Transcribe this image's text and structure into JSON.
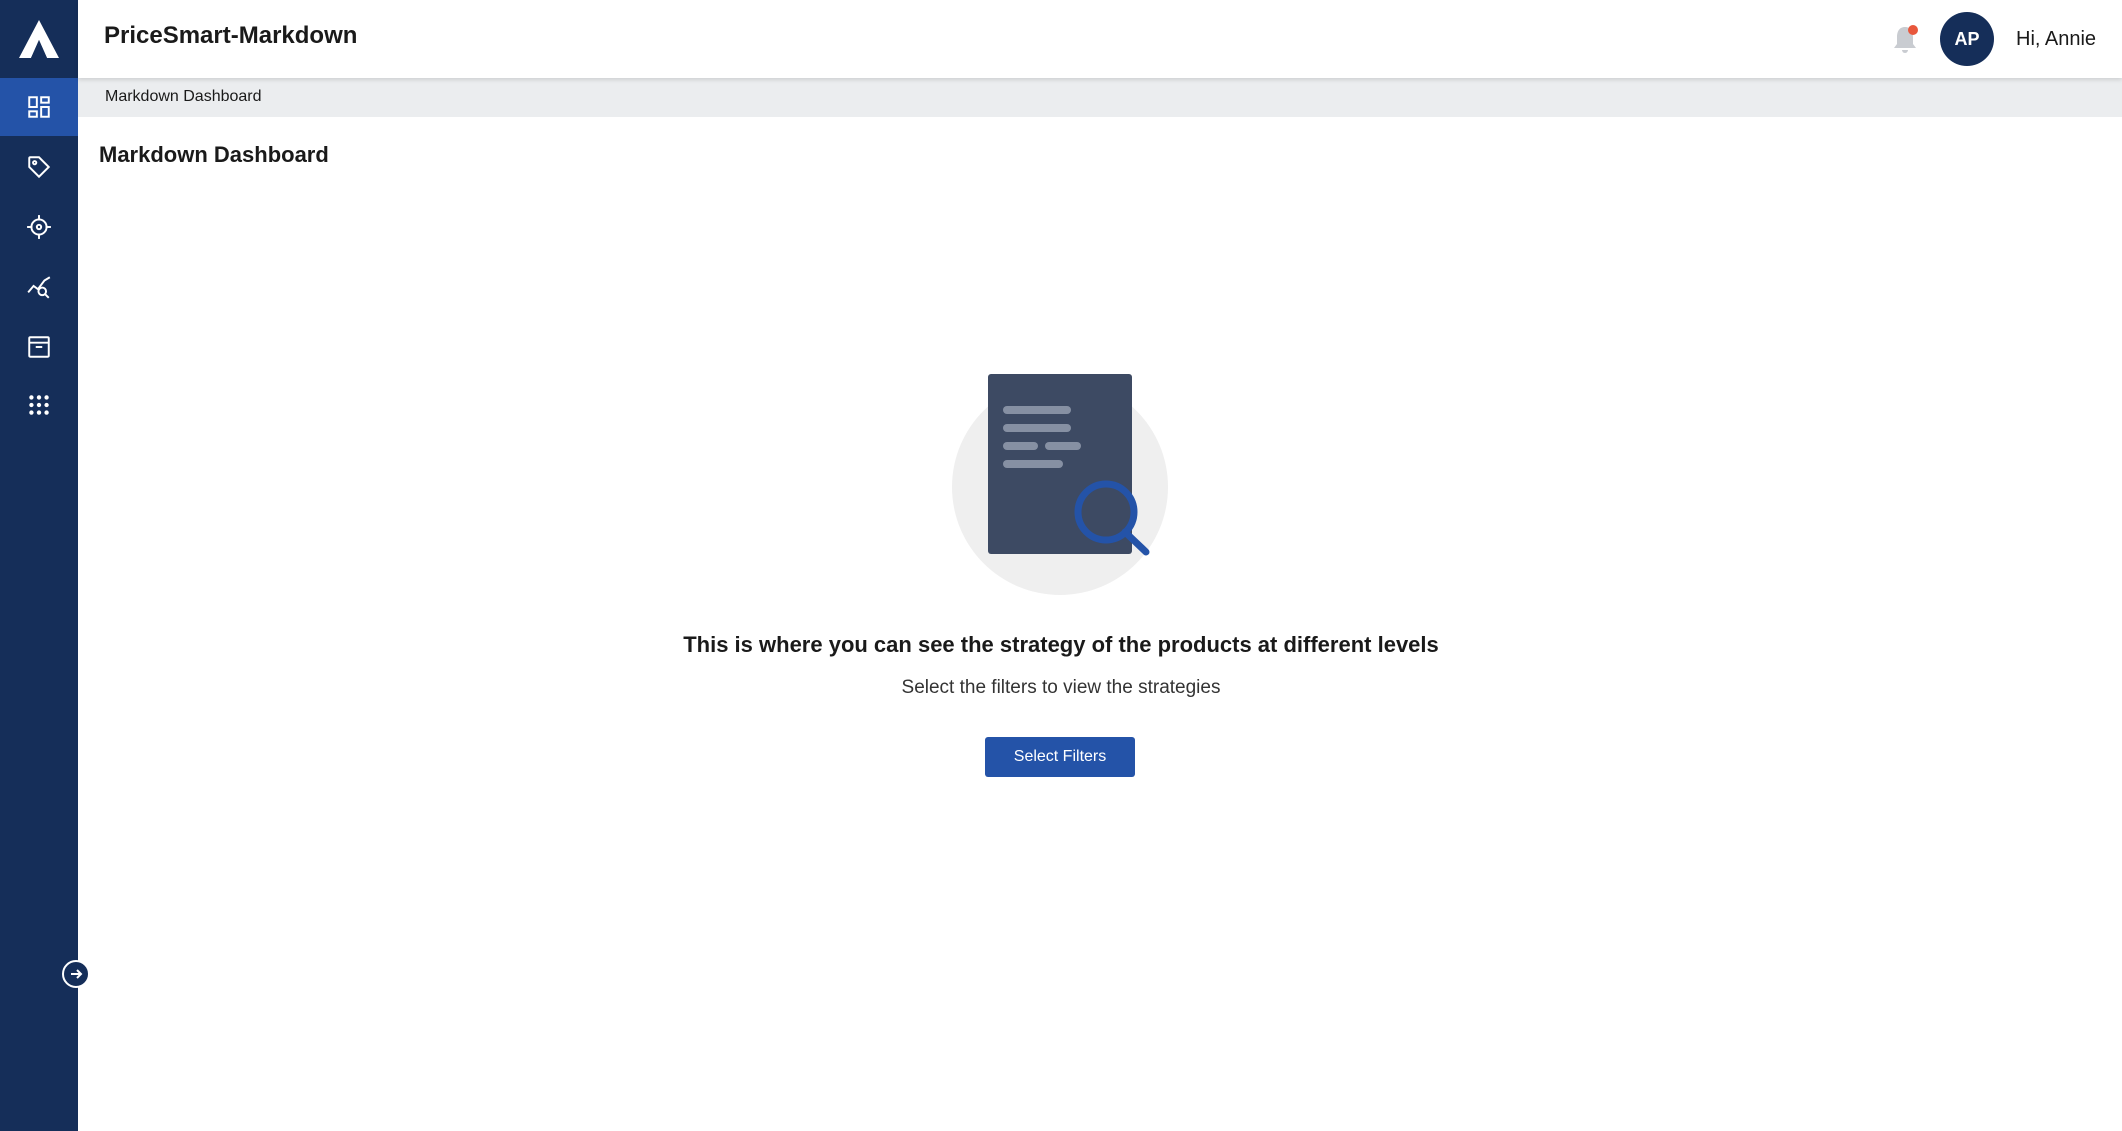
{
  "header": {
    "app_title": "PriceSmart-Markdown",
    "avatar_initials": "AP",
    "greeting": "Hi, Annie"
  },
  "sidebar": {
    "items": [
      {
        "icon": "dashboard-icon",
        "active": true
      },
      {
        "icon": "tag-icon",
        "active": false
      },
      {
        "icon": "crosshair-icon",
        "active": false
      },
      {
        "icon": "analytics-search-icon",
        "active": false
      },
      {
        "icon": "archive-icon",
        "active": false
      },
      {
        "icon": "apps-grid-icon",
        "active": false
      }
    ]
  },
  "breadcrumb": "Markdown Dashboard",
  "page_title": "Markdown Dashboard",
  "empty_state": {
    "heading": "This is where you can see the strategy of the products at different levels",
    "subheading": "Select the filters to view the strategies",
    "button_label": "Select Filters"
  },
  "colors": {
    "sidebar_bg": "#152e59",
    "accent": "#2453a8",
    "notification_dot": "#e8573c"
  }
}
